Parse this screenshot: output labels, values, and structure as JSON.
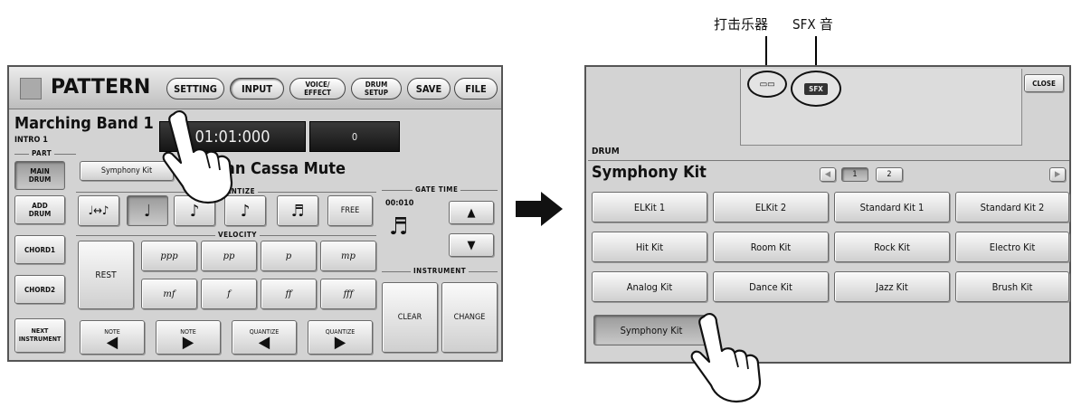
{
  "callouts": {
    "percussion": "打击乐器",
    "sfx": "SFX 音"
  },
  "left": {
    "title": "PATTERN",
    "tabs": [
      "SETTING",
      "INPUT",
      "VOICE/\nEFFECT",
      "DRUM\nSETUP",
      "SAVE",
      "FILE"
    ],
    "pattern_name": "Marching Band 1",
    "section": "INTRO 1",
    "time_display": "01:01:000",
    "value_display": "0",
    "part_label": "PART",
    "parts": [
      "MAIN\nDRUM",
      "ADD\nDRUM",
      "CHORD1",
      "CHORD2"
    ],
    "next_instrument": "NEXT\nINSTRUMENT",
    "kit_button": "Symphony Kit",
    "instrument_name": "C1:Gran Cassa Mute",
    "quantize_label": "QUANTIZE",
    "quantize_free": "FREE",
    "velocity_label": "VELOCITY",
    "rest": "REST",
    "dynamics": [
      "ppp",
      "pp",
      "p",
      "mp",
      "mf",
      "f",
      "ff",
      "fff"
    ],
    "gate_label": "GATE TIME",
    "gate_value": "00:010",
    "instrument_label": "INSTRUMENT",
    "clear": "CLEAR",
    "change": "CHANGE",
    "nav": [
      {
        "label": "NOTE",
        "dir": "◀"
      },
      {
        "label": "NOTE",
        "dir": "▶"
      },
      {
        "label": "QUANTIZE",
        "dir": "◀"
      },
      {
        "label": "QUANTIZE",
        "dir": "▶"
      }
    ]
  },
  "right": {
    "close": "CLOSE",
    "sfx_badge": "SFX",
    "category": "DRUM",
    "selected_kit": "Symphony Kit",
    "pages": [
      "1",
      "2"
    ],
    "kits": [
      "ELKit 1",
      "ELKit 2",
      "Standard Kit 1",
      "Standard Kit 2",
      "Hit Kit",
      "Room Kit",
      "Rock Kit",
      "Electro Kit",
      "Analog Kit",
      "Dance Kit",
      "Jazz Kit",
      "Brush Kit",
      "Symphony Kit"
    ]
  }
}
